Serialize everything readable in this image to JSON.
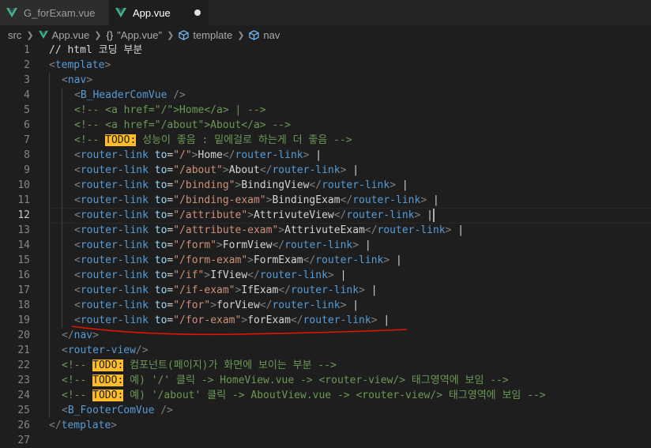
{
  "tabs": [
    {
      "label": "G_forExam.vue",
      "active": false
    },
    {
      "label": "App.vue",
      "active": true,
      "dirty": true
    }
  ],
  "breadcrumb": [
    {
      "label": "src",
      "icon": ""
    },
    {
      "label": "App.vue",
      "icon": "vue-icon"
    },
    {
      "label": "\"App.vue\"",
      "icon": "braces-icon"
    },
    {
      "label": "template",
      "icon": "cube-icon"
    },
    {
      "label": "nav",
      "icon": "cube-icon"
    }
  ],
  "colors": {
    "background": "#1e1e1e",
    "tag": "#569cd6",
    "attribute": "#9cdcfe",
    "string": "#ce9178",
    "comment": "#6a9955",
    "todo_bg": "#ffbd2a",
    "annotation_underline": "#e51400"
  },
  "editor": {
    "current_line": 12,
    "lines": [
      {
        "n": "1",
        "indent": 0,
        "tokens": [
          [
            "text",
            "// html 코딩 부분"
          ]
        ]
      },
      {
        "n": "2",
        "indent": 0,
        "tokens": [
          [
            "tag",
            "<"
          ],
          [
            "name",
            "template"
          ],
          [
            "tag",
            ">"
          ]
        ]
      },
      {
        "n": "3",
        "indent": 1,
        "tokens": [
          [
            "tag",
            "<"
          ],
          [
            "name",
            "nav"
          ],
          [
            "tag",
            ">"
          ]
        ]
      },
      {
        "n": "4",
        "indent": 2,
        "tokens": [
          [
            "tag",
            "<"
          ],
          [
            "name",
            "B_HeaderComVue"
          ],
          [
            "tag",
            " />"
          ]
        ]
      },
      {
        "n": "5",
        "indent": 2,
        "tokens": [
          [
            "com",
            "<!-- <a href=\"/\">Home</a> | -->"
          ]
        ]
      },
      {
        "n": "6",
        "indent": 2,
        "tokens": [
          [
            "com",
            "<!-- <a href=\"/about\">About</a> -->"
          ]
        ]
      },
      {
        "n": "7",
        "indent": 2,
        "tokens": [
          [
            "com",
            "<!-- "
          ],
          [
            "todo",
            "TODO:"
          ],
          [
            "com",
            " 성능이 좋음 : 밑에걸로 하는게 더 좋음 -->"
          ]
        ]
      },
      {
        "n": "8",
        "indent": 2,
        "tokens": [
          [
            "tag",
            "<"
          ],
          [
            "name",
            "router-link"
          ],
          [
            "text",
            " "
          ],
          [
            "attr",
            "to"
          ],
          [
            "text",
            "="
          ],
          [
            "str",
            "\"/\""
          ],
          [
            "tag",
            ">"
          ],
          [
            "text",
            "Home"
          ],
          [
            "tag",
            "</"
          ],
          [
            "name",
            "router-link"
          ],
          [
            "tag",
            ">"
          ],
          [
            "text",
            " |"
          ]
        ]
      },
      {
        "n": "9",
        "indent": 2,
        "tokens": [
          [
            "tag",
            "<"
          ],
          [
            "name",
            "router-link"
          ],
          [
            "text",
            " "
          ],
          [
            "attr",
            "to"
          ],
          [
            "text",
            "="
          ],
          [
            "str",
            "\"/about\""
          ],
          [
            "tag",
            ">"
          ],
          [
            "text",
            "About"
          ],
          [
            "tag",
            "</"
          ],
          [
            "name",
            "router-link"
          ],
          [
            "tag",
            ">"
          ],
          [
            "text",
            " |"
          ]
        ]
      },
      {
        "n": "10",
        "indent": 2,
        "tokens": [
          [
            "tag",
            "<"
          ],
          [
            "name",
            "router-link"
          ],
          [
            "text",
            " "
          ],
          [
            "attr",
            "to"
          ],
          [
            "text",
            "="
          ],
          [
            "str",
            "\"/binding\""
          ],
          [
            "tag",
            ">"
          ],
          [
            "text",
            "BindingView"
          ],
          [
            "tag",
            "</"
          ],
          [
            "name",
            "router-link"
          ],
          [
            "tag",
            ">"
          ],
          [
            "text",
            " |"
          ]
        ]
      },
      {
        "n": "11",
        "indent": 2,
        "tokens": [
          [
            "tag",
            "<"
          ],
          [
            "name",
            "router-link"
          ],
          [
            "text",
            " "
          ],
          [
            "attr",
            "to"
          ],
          [
            "text",
            "="
          ],
          [
            "str",
            "\"/binding-exam\""
          ],
          [
            "tag",
            ">"
          ],
          [
            "text",
            "BindingExam"
          ],
          [
            "tag",
            "</"
          ],
          [
            "name",
            "router-link"
          ],
          [
            "tag",
            ">"
          ],
          [
            "text",
            " |"
          ]
        ]
      },
      {
        "n": "12",
        "indent": 2,
        "cursor": true,
        "tokens": [
          [
            "tag",
            "<"
          ],
          [
            "name",
            "router-link"
          ],
          [
            "text",
            " "
          ],
          [
            "attr",
            "to"
          ],
          [
            "text",
            "="
          ],
          [
            "str",
            "\"/attribute\""
          ],
          [
            "tag",
            ">"
          ],
          [
            "text",
            "AttrivuteView"
          ],
          [
            "tag",
            "</"
          ],
          [
            "name",
            "router-link"
          ],
          [
            "tag",
            ">"
          ],
          [
            "text",
            " |"
          ]
        ]
      },
      {
        "n": "13",
        "indent": 2,
        "tokens": [
          [
            "tag",
            "<"
          ],
          [
            "name",
            "router-link"
          ],
          [
            "text",
            " "
          ],
          [
            "attr",
            "to"
          ],
          [
            "text",
            "="
          ],
          [
            "str",
            "\"/attribute-exam\""
          ],
          [
            "tag",
            ">"
          ],
          [
            "text",
            "AttrivuteExam"
          ],
          [
            "tag",
            "</"
          ],
          [
            "name",
            "router-link"
          ],
          [
            "tag",
            ">"
          ],
          [
            "text",
            " |"
          ]
        ]
      },
      {
        "n": "14",
        "indent": 2,
        "tokens": [
          [
            "tag",
            "<"
          ],
          [
            "name",
            "router-link"
          ],
          [
            "text",
            " "
          ],
          [
            "attr",
            "to"
          ],
          [
            "text",
            "="
          ],
          [
            "str",
            "\"/form\""
          ],
          [
            "tag",
            ">"
          ],
          [
            "text",
            "FormView"
          ],
          [
            "tag",
            "</"
          ],
          [
            "name",
            "router-link"
          ],
          [
            "tag",
            ">"
          ],
          [
            "text",
            " |"
          ]
        ]
      },
      {
        "n": "15",
        "indent": 2,
        "tokens": [
          [
            "tag",
            "<"
          ],
          [
            "name",
            "router-link"
          ],
          [
            "text",
            " "
          ],
          [
            "attr",
            "to"
          ],
          [
            "text",
            "="
          ],
          [
            "str",
            "\"/form-exam\""
          ],
          [
            "tag",
            ">"
          ],
          [
            "text",
            "FormExam"
          ],
          [
            "tag",
            "</"
          ],
          [
            "name",
            "router-link"
          ],
          [
            "tag",
            ">"
          ],
          [
            "text",
            " |"
          ]
        ]
      },
      {
        "n": "16",
        "indent": 2,
        "tokens": [
          [
            "tag",
            "<"
          ],
          [
            "name",
            "router-link"
          ],
          [
            "text",
            " "
          ],
          [
            "attr",
            "to"
          ],
          [
            "text",
            "="
          ],
          [
            "str",
            "\"/if\""
          ],
          [
            "tag",
            ">"
          ],
          [
            "text",
            "IfView"
          ],
          [
            "tag",
            "</"
          ],
          [
            "name",
            "router-link"
          ],
          [
            "tag",
            ">"
          ],
          [
            "text",
            " |"
          ]
        ]
      },
      {
        "n": "17",
        "indent": 2,
        "tokens": [
          [
            "tag",
            "<"
          ],
          [
            "name",
            "router-link"
          ],
          [
            "text",
            " "
          ],
          [
            "attr",
            "to"
          ],
          [
            "text",
            "="
          ],
          [
            "str",
            "\"/if-exam\""
          ],
          [
            "tag",
            ">"
          ],
          [
            "text",
            "IfExam"
          ],
          [
            "tag",
            "</"
          ],
          [
            "name",
            "router-link"
          ],
          [
            "tag",
            ">"
          ],
          [
            "text",
            " |"
          ]
        ]
      },
      {
        "n": "18",
        "indent": 2,
        "tokens": [
          [
            "tag",
            "<"
          ],
          [
            "name",
            "router-link"
          ],
          [
            "text",
            " "
          ],
          [
            "attr",
            "to"
          ],
          [
            "text",
            "="
          ],
          [
            "str",
            "\"/for\""
          ],
          [
            "tag",
            ">"
          ],
          [
            "text",
            "forView"
          ],
          [
            "tag",
            "</"
          ],
          [
            "name",
            "router-link"
          ],
          [
            "tag",
            ">"
          ],
          [
            "text",
            " |"
          ]
        ]
      },
      {
        "n": "19",
        "indent": 2,
        "underline": true,
        "tokens": [
          [
            "tag",
            "<"
          ],
          [
            "name",
            "router-link"
          ],
          [
            "text",
            " "
          ],
          [
            "attr",
            "to"
          ],
          [
            "text",
            "="
          ],
          [
            "str",
            "\"/for-exam\""
          ],
          [
            "tag",
            ">"
          ],
          [
            "text",
            "forExam"
          ],
          [
            "tag",
            "</"
          ],
          [
            "name",
            "router-link"
          ],
          [
            "tag",
            ">"
          ],
          [
            "text",
            " |"
          ]
        ]
      },
      {
        "n": "20",
        "indent": 1,
        "tokens": [
          [
            "tag",
            "</"
          ],
          [
            "name",
            "nav"
          ],
          [
            "tag",
            ">"
          ]
        ]
      },
      {
        "n": "21",
        "indent": 1,
        "tokens": [
          [
            "tag",
            "<"
          ],
          [
            "name",
            "router-view"
          ],
          [
            "tag",
            "/>"
          ]
        ]
      },
      {
        "n": "22",
        "indent": 1,
        "tokens": [
          [
            "com",
            "<!-- "
          ],
          [
            "todo",
            "TODO:"
          ],
          [
            "com",
            " 컴포넌트(페이지)가 화면에 보이는 부분 -->"
          ]
        ]
      },
      {
        "n": "23",
        "indent": 1,
        "tokens": [
          [
            "com",
            "<!-- "
          ],
          [
            "todo",
            "TODO:"
          ],
          [
            "com",
            " 예) '/' 클릭 -> HomeView.vue -> <router-view/> 태그영역에 보임 -->"
          ]
        ]
      },
      {
        "n": "24",
        "indent": 1,
        "tokens": [
          [
            "com",
            "<!-- "
          ],
          [
            "todo",
            "TODO:"
          ],
          [
            "com",
            " 예) '/about' 클릭 -> AboutView.vue -> <router-view/> 태그영역에 보임 -->"
          ]
        ]
      },
      {
        "n": "25",
        "indent": 1,
        "tokens": [
          [
            "tag",
            "<"
          ],
          [
            "name",
            "B_FooterComVue"
          ],
          [
            "tag",
            " />"
          ]
        ]
      },
      {
        "n": "26",
        "indent": 0,
        "tokens": [
          [
            "tag",
            "</"
          ],
          [
            "name",
            "template"
          ],
          [
            "tag",
            ">"
          ]
        ]
      },
      {
        "n": "27",
        "indent": 0,
        "tokens": []
      }
    ]
  }
}
